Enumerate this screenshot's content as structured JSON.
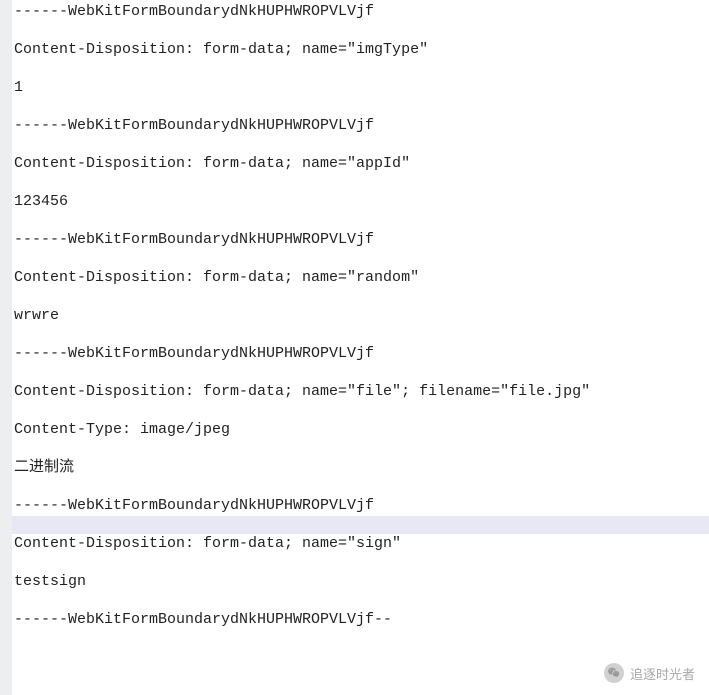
{
  "lines": [
    {
      "text": "------WebKitFormBoundarydNkHUPHWROPVLVjf",
      "hl": false
    },
    {
      "text": "",
      "hl": false
    },
    {
      "text": "Content-Disposition: form-data; name=\"imgType\"",
      "hl": false
    },
    {
      "text": "",
      "hl": false
    },
    {
      "text": "1",
      "hl": false
    },
    {
      "text": "",
      "hl": false
    },
    {
      "text": "------WebKitFormBoundarydNkHUPHWROPVLVjf",
      "hl": false
    },
    {
      "text": "",
      "hl": false
    },
    {
      "text": "Content-Disposition: form-data; name=\"appId\"",
      "hl": false
    },
    {
      "text": "",
      "hl": false
    },
    {
      "text": "123456",
      "hl": false
    },
    {
      "text": "",
      "hl": false
    },
    {
      "text": "------WebKitFormBoundarydNkHUPHWROPVLVjf",
      "hl": false
    },
    {
      "text": "",
      "hl": false
    },
    {
      "text": "Content-Disposition: form-data; name=\"random\"",
      "hl": false
    },
    {
      "text": "",
      "hl": false
    },
    {
      "text": "wrwre",
      "hl": false
    },
    {
      "text": "",
      "hl": false
    },
    {
      "text": "------WebKitFormBoundarydNkHUPHWROPVLVjf",
      "hl": false
    },
    {
      "text": "",
      "hl": false
    },
    {
      "text": "Content-Disposition: form-data; name=\"file\"; filename=\"file.jpg\"",
      "hl": false
    },
    {
      "text": "",
      "hl": false
    },
    {
      "text": "Content-Type: image/jpeg",
      "hl": false
    },
    {
      "text": "",
      "hl": false
    },
    {
      "text": "二进制流",
      "hl": false
    },
    {
      "text": "",
      "hl": false
    },
    {
      "text": "------WebKitFormBoundarydNkHUPHWROPVLVjf",
      "hl": false
    },
    {
      "text": "",
      "hl": true
    },
    {
      "text": "Content-Disposition: form-data; name=\"sign\"",
      "hl": false
    },
    {
      "text": "",
      "hl": false
    },
    {
      "text": "testsign",
      "hl": false
    },
    {
      "text": "",
      "hl": false
    },
    {
      "text": "------WebKitFormBoundarydNkHUPHWROPVLVjf--",
      "hl": false
    }
  ],
  "watermark": {
    "label": "追逐时光者"
  }
}
